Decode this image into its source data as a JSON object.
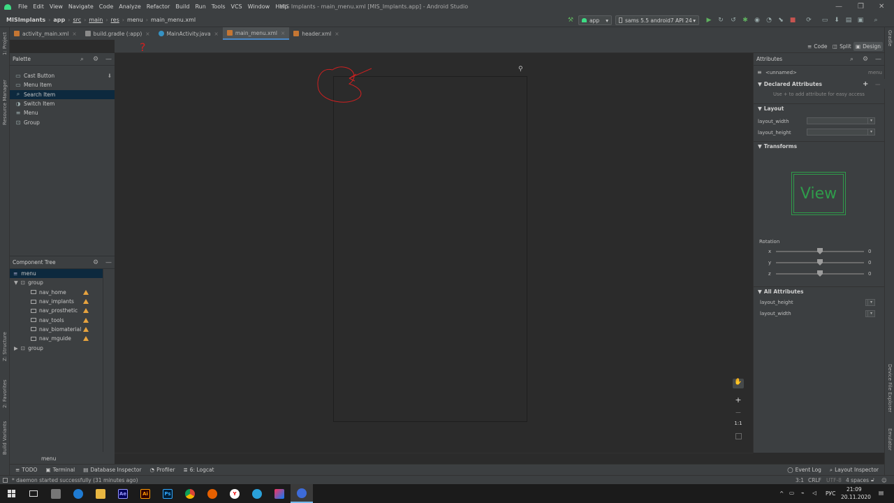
{
  "window": {
    "menus": [
      "File",
      "Edit",
      "View",
      "Navigate",
      "Code",
      "Analyze",
      "Refactor",
      "Build",
      "Run",
      "Tools",
      "VCS",
      "Window",
      "Help"
    ],
    "title": "MIS Implants - main_menu.xml [MIS_Implants.app] - Android Studio",
    "controls": {
      "minimize": "—",
      "maximize": "❒",
      "close": "✕"
    }
  },
  "breadcrumbs": [
    "MISImplants",
    "app",
    "src",
    "main",
    "res",
    "menu",
    "main_menu.xml"
  ],
  "run_config": {
    "module": "app",
    "device": "sams 5.5 android7 API 24"
  },
  "editor_tabs": [
    {
      "label": "activity_main.xml",
      "close": "×",
      "icon_color": "#c57633"
    },
    {
      "label": "build.gradle (:app)",
      "close": "×",
      "icon_color": "#8a8a8a"
    },
    {
      "label": "MainActivity.java",
      "close": "×",
      "icon_color": "#3592c4"
    },
    {
      "label": "main_menu.xml",
      "close": "×",
      "icon_color": "#c57633",
      "active": true
    },
    {
      "label": "header.xml",
      "close": "×",
      "icon_color": "#c57633"
    }
  ],
  "left_tool_windows": [
    "1: Project",
    "Resource Manager",
    "Z: Structure",
    "2: Favorites",
    "Build Variants"
  ],
  "right_tool_windows": [
    "Gradle",
    "Device File Explorer",
    "Emulator"
  ],
  "design_modes": [
    "Code",
    "Split",
    "Design"
  ],
  "palette": {
    "title": "Palette",
    "items": [
      "Cast Button",
      "Menu Item",
      "Search Item",
      "Switch Item",
      "Menu",
      "Group"
    ],
    "selected_index": 2
  },
  "component_tree": {
    "title": "Component Tree",
    "root": "menu",
    "group1": "group",
    "children": [
      "nav_home",
      "nav_implants",
      "nav_prosthetic",
      "nav_tools",
      "nav_biomaterial",
      "nav_mguide"
    ],
    "group2": "group"
  },
  "canvas": {
    "zoom_label": "1:1",
    "footer_label": "menu"
  },
  "annotation": {
    "mark": "?",
    "color": "#d02020"
  },
  "attributes": {
    "title": "Attributes",
    "component": "<unnamed>",
    "component_type": "menu",
    "declared": {
      "title": "Declared Attributes",
      "hint": "Use + to add attribute for easy access"
    },
    "layout": {
      "title": "Layout",
      "rows": [
        "layout_width",
        "layout_height"
      ]
    },
    "transforms": {
      "title": "Transforms",
      "preview": "View",
      "rotation_label": "Rotation",
      "axes": [
        "x",
        "y",
        "z"
      ],
      "values": [
        "0",
        "0",
        "0"
      ],
      "slider_level": 0.5
    },
    "all_attributes": {
      "title": "All Attributes",
      "rows": [
        "layout_height",
        "layout_width"
      ]
    }
  },
  "bottom_tabs": [
    "TODO",
    "Terminal",
    "Database Inspector",
    "Profiler",
    "6: Logcat"
  ],
  "bottom_right_tabs": [
    "Event Log",
    "Layout Inspector"
  ],
  "status": {
    "message": "* daemon started successfully (31 minutes ago)",
    "position": "3:1",
    "line_sep": "CRLF",
    "encoding": "UTF-8",
    "indent": "4 spaces"
  },
  "taskbar": {
    "apps": [
      {
        "label": "Ae",
        "color": "#9999ff",
        "bg": "#00005b"
      },
      {
        "label": "Ai",
        "color": "#ff9a00",
        "bg": "#330000"
      },
      {
        "label": "Ps",
        "color": "#31a8ff",
        "bg": "#001e36"
      }
    ],
    "lang": "РУС",
    "time": "21:09",
    "date": "20.11.2020"
  }
}
